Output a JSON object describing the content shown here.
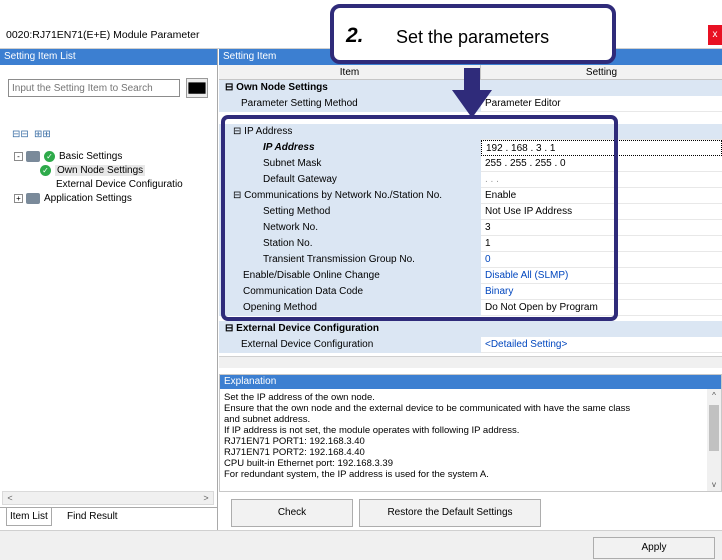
{
  "window": {
    "title": "0020:RJ71EN71(E+E) Module Parameter",
    "close_glyph": "x"
  },
  "callout": {
    "number": "2.",
    "text": "Set the parameters"
  },
  "left": {
    "header": "Setting Item List",
    "search_placeholder": "Input the Setting Item to Search",
    "tree": [
      {
        "label": "Basic Settings",
        "expander": "-"
      },
      {
        "label": "Own Node Settings"
      },
      {
        "label": "External Device Configuratio"
      },
      {
        "label": "Application Settings",
        "expander": "+"
      }
    ],
    "tabs": [
      "Item List",
      "Find Result"
    ]
  },
  "grid": {
    "header": "Setting Item",
    "col_item": "Item",
    "col_setting": "Setting",
    "rows": [
      {
        "label": "Own Node Settings",
        "value": "",
        "group": true
      },
      {
        "label": "Parameter Setting Method",
        "value": "Parameter Editor"
      },
      {
        "label": "IP Address",
        "value": ""
      },
      {
        "label": "IP Address",
        "value": "192 . 168 . 3 . 1"
      },
      {
        "label": "Subnet Mask",
        "value": "255 . 255 . 255 . 0"
      },
      {
        "label": "Default Gateway",
        "value": ". . ."
      },
      {
        "label": "Communications by Network No./Station No.",
        "value": "Enable"
      },
      {
        "label": "Setting Method",
        "value": "Not Use IP Address"
      },
      {
        "label": "Network No.",
        "value": "3"
      },
      {
        "label": "Station No.",
        "value": "1"
      },
      {
        "label": "Transient Transmission Group No.",
        "value": "0"
      },
      {
        "label": "Enable/Disable Online Change",
        "value": "Disable All (SLMP)"
      },
      {
        "label": "Communication Data Code",
        "value": "Binary"
      },
      {
        "label": "Opening Method",
        "value": "Do Not Open by Program"
      },
      {
        "label": "External Device Configuration",
        "value": "",
        "group": true
      },
      {
        "label": "External Device Configuration",
        "value": "<Detailed Setting>"
      }
    ]
  },
  "explanation": {
    "header": "Explanation",
    "lines": [
      "Set the IP address of the own node.",
      "Ensure that the own node and the external device to be communicated with have the same class",
      "and subnet address.",
      "If IP address is not set, the module operates with following IP address.",
      "RJ71EN71 PORT1: 192.168.3.40",
      "RJ71EN71 PORT2: 192.168.4.40",
      "CPU built-in Ethernet port: 192.168.3.39",
      "For redundant system, the IP address is used for the system A."
    ]
  },
  "buttons": {
    "check": "Check",
    "restore": "Restore the Default Settings",
    "apply": "Apply"
  },
  "colors": {
    "header_blue": "#3c7fd1",
    "callout_border": "#2f2b7a",
    "link_blue": "#0046be"
  }
}
